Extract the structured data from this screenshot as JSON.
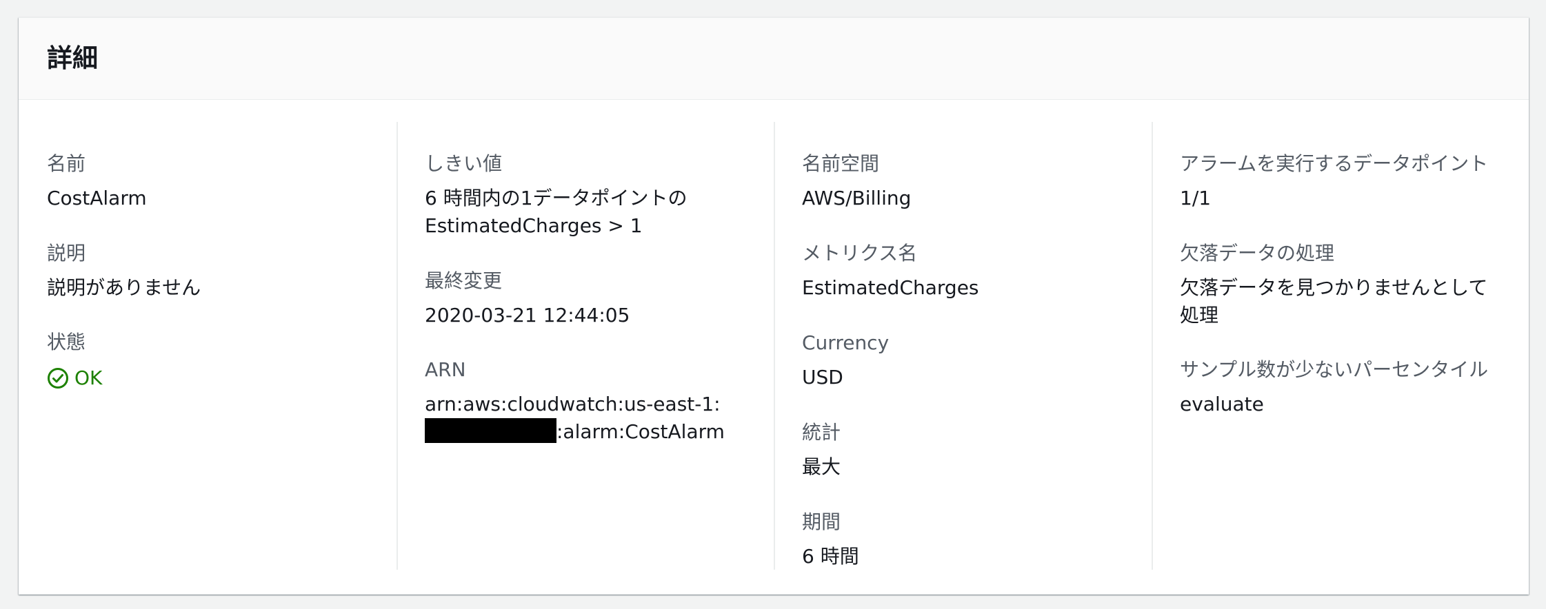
{
  "panel": {
    "title": "詳細"
  },
  "col1": {
    "name_label": "名前",
    "name_value": "CostAlarm",
    "description_label": "説明",
    "description_value": "説明がありません",
    "state_label": "状態",
    "state_value": "OK",
    "state_icon": "check-circle-icon",
    "state_color": "#1d8102"
  },
  "col2": {
    "threshold_label": "しきい値",
    "threshold_line1": "6 時間内の1データポイントの",
    "threshold_line2": "EstimatedCharges > 1",
    "last_change_label": "最終変更",
    "last_change_value": "2020-03-21 12:44:05",
    "arn_label": "ARN",
    "arn_prefix": "arn:aws:cloudwatch:us-east-1:",
    "arn_suffix": ":alarm:CostAlarm"
  },
  "col3": {
    "namespace_label": "名前空間",
    "namespace_value": "AWS/Billing",
    "metric_name_label": "メトリクス名",
    "metric_name_value": "EstimatedCharges",
    "currency_label": "Currency",
    "currency_value": "USD",
    "statistic_label": "統計",
    "statistic_value": "最大",
    "period_label": "期間",
    "period_value": "6 時間"
  },
  "col4": {
    "datapoints_label": "アラームを実行するデータポイント",
    "datapoints_value": "1/1",
    "missing_data_label": "欠落データの処理",
    "missing_data_value": "欠落データを見つかりませんとして処理",
    "percentile_label": "サンプル数が少ないパーセンタイル",
    "percentile_value": "evaluate"
  }
}
